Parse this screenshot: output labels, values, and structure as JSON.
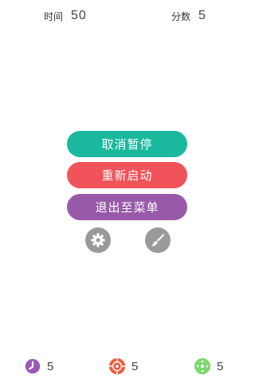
{
  "hud": {
    "time_label": "时间",
    "time_value": "50",
    "score_label": "分数",
    "score_value": "5"
  },
  "menu": {
    "resume_label": "取消暂停",
    "restart_label": "重新启动",
    "exit_label": "退出至菜单"
  },
  "icons": {
    "settings": "gear-icon",
    "theme": "brush-icon"
  },
  "powerups": [
    {
      "icon": "clock-icon",
      "count": "5",
      "color": "#9b59b6"
    },
    {
      "icon": "crosshair-icon",
      "count": "5",
      "color": "#ef5a3c"
    },
    {
      "icon": "expand-icon",
      "count": "5",
      "color": "#7ed86f"
    }
  ],
  "colors": {
    "resume": "#1ab99f",
    "restart": "#f05359",
    "exit": "#985aa8",
    "icon_button": "#9a9a9a"
  }
}
